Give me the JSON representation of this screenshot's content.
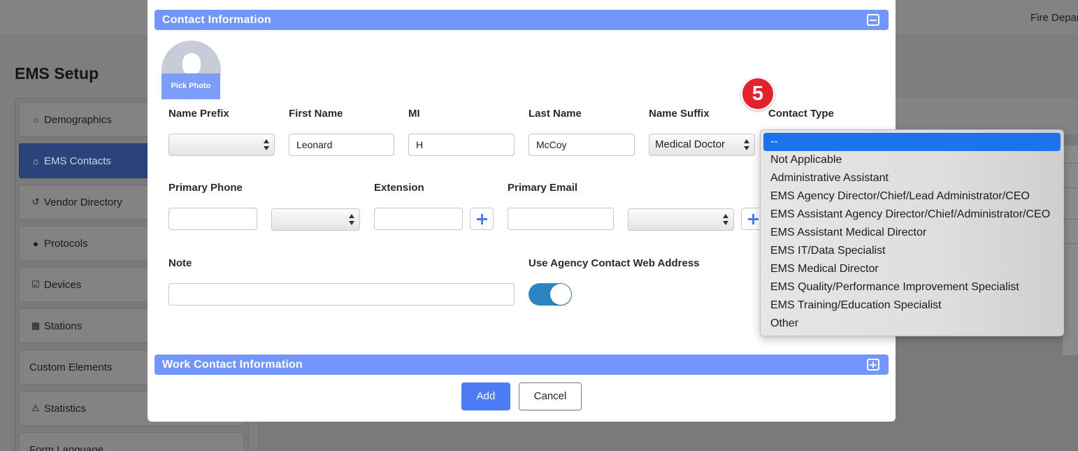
{
  "header": {
    "agency_text": "Fire Depar"
  },
  "page": {
    "title": "EMS Setup"
  },
  "sidebar": {
    "items": [
      {
        "label": "Demographics",
        "icon": "circle-icon"
      },
      {
        "label": "EMS Contacts",
        "icon": "home-icon",
        "active": true
      },
      {
        "label": "Vendor Directory",
        "icon": "history-icon"
      },
      {
        "label": "Protocols",
        "icon": "user-icon"
      },
      {
        "label": "Devices",
        "icon": "checkbox-icon"
      },
      {
        "label": "Stations",
        "icon": "building-icon"
      },
      {
        "label": "Custom Elements",
        "icon": ""
      },
      {
        "label": "Statistics",
        "icon": "warning-icon"
      },
      {
        "label": "Form Language",
        "icon": ""
      }
    ]
  },
  "modal": {
    "contact_section": {
      "title": "Contact Information",
      "toggle": "minus"
    },
    "photo": {
      "label": "Pick Photo"
    },
    "fields": {
      "name_prefix": {
        "label": "Name Prefix",
        "value": ""
      },
      "first_name": {
        "label": "First Name",
        "value": "Leonard"
      },
      "mi": {
        "label": "MI",
        "value": "H"
      },
      "last_name": {
        "label": "Last Name",
        "value": "McCoy"
      },
      "name_suffix": {
        "label": "Name Suffix",
        "value": "Medical Doctor"
      },
      "contact_type": {
        "label": "Contact Type"
      },
      "primary_phone": {
        "label": "Primary Phone",
        "value": ""
      },
      "extension": {
        "label": "Extension",
        "value": ""
      },
      "primary_email": {
        "label": "Primary Email",
        "value": ""
      },
      "note": {
        "label": "Note",
        "value": ""
      },
      "use_agency_web": {
        "label": "Use Agency Contact Web Address",
        "on": true
      }
    },
    "work_section": {
      "title": "Work Contact Information",
      "toggle": "plus"
    },
    "buttons": {
      "add": "Add",
      "cancel": "Cancel"
    }
  },
  "step_badge": "5",
  "contact_type_dropdown": {
    "selected_index": 0,
    "options": [
      "--",
      "Not Applicable",
      "Administrative Assistant",
      "EMS Agency Director/Chief/Lead Administrator/CEO",
      "EMS Assistant Agency Director/Chief/Administrator/CEO",
      "EMS Assistant Medical Director",
      "EMS IT/Data Specialist",
      "EMS Medical Director",
      "EMS Quality/Performance Improvement Specialist",
      "EMS Training/Education Specialist",
      "Other"
    ]
  },
  "colors": {
    "section_bar": "#7296fb",
    "primary_button": "#4c7df4",
    "toggle_on": "#2b86bf",
    "badge": "#e3222b",
    "dropdown_selected": "#1b74ec"
  }
}
